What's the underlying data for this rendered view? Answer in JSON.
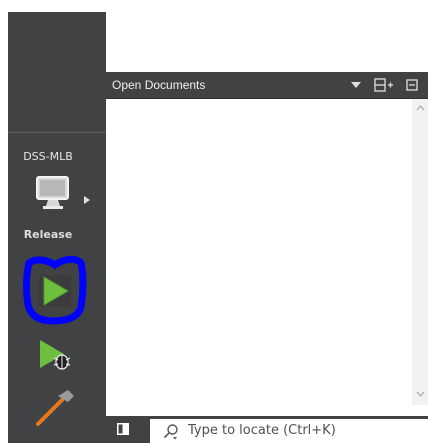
{
  "sidebar": {
    "kit_name": "DSS-MLB",
    "build_config": "Release",
    "icons": {
      "target": "monitor-icon",
      "run": "run-icon",
      "debug": "debug-icon",
      "build": "hammer-icon"
    }
  },
  "open_documents": {
    "title": "Open Documents"
  },
  "locator": {
    "placeholder": "Type to locate (Ctrl+K)"
  },
  "colors": {
    "sidebar_bg": "#404244",
    "run_green": "#6fbf3f",
    "highlight_annotation": "#0000ff",
    "hammer_orange": "#e8781c"
  }
}
